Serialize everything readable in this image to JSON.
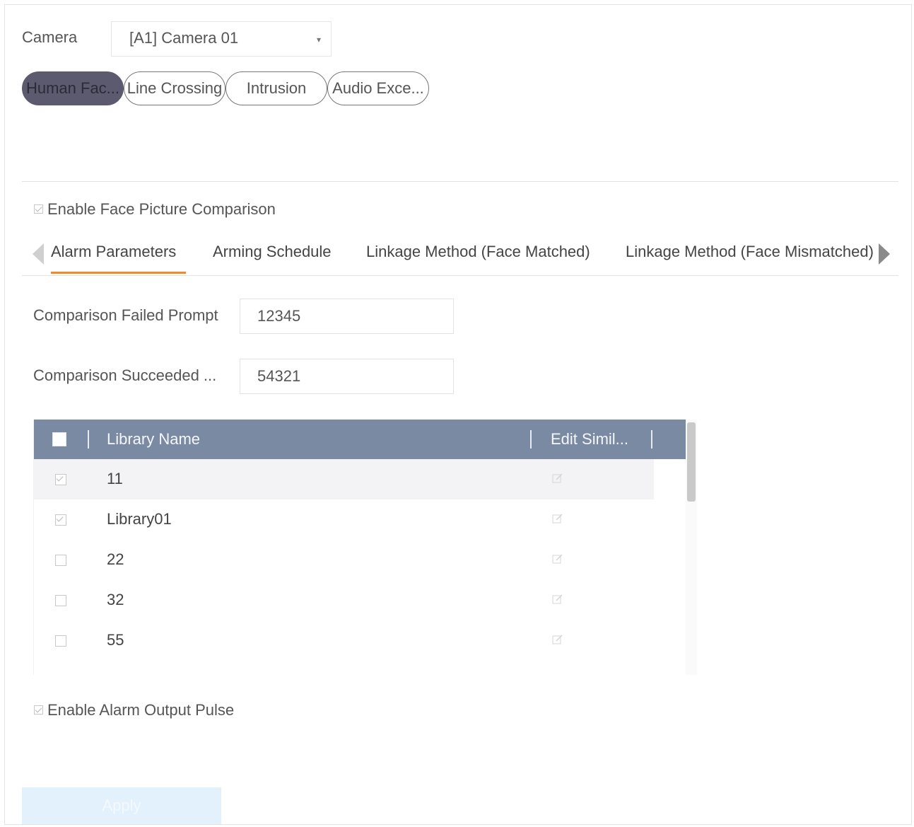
{
  "camera": {
    "label": "Camera",
    "selected": "[A1] Camera 01"
  },
  "event_tabs": [
    {
      "label": "Human Fac..."
    },
    {
      "label": "Line Crossing"
    },
    {
      "label": "Intrusion"
    },
    {
      "label": "Audio Exce..."
    }
  ],
  "enable_face_comparison": {
    "label": "Enable Face Picture Comparison",
    "checked": true
  },
  "sub_tabs": {
    "items": [
      {
        "label": "Alarm Parameters"
      },
      {
        "label": "Arming Schedule"
      },
      {
        "label": "Linkage Method (Face Matched)"
      },
      {
        "label": "Linkage Method (Face Mismatched)"
      }
    ]
  },
  "fields": {
    "failed_prompt": {
      "label": "Comparison Failed Prompt",
      "value": "12345"
    },
    "succeeded_prompt": {
      "label": "Comparison Succeeded ...",
      "value": "54321"
    }
  },
  "library_table": {
    "columns": {
      "name": "Library Name",
      "edit": "Edit Simil..."
    },
    "rows": [
      {
        "name": "11",
        "checked": true
      },
      {
        "name": "Library01",
        "checked": true
      },
      {
        "name": "22",
        "checked": false
      },
      {
        "name": "32",
        "checked": false
      },
      {
        "name": "55",
        "checked": false
      }
    ]
  },
  "enable_alarm_output_pulse": {
    "label": "Enable Alarm Output Pulse",
    "checked": true
  },
  "apply_button": {
    "label": "Apply"
  },
  "colors": {
    "active_tab_underline": "#f08a2a",
    "table_header_bg": "#7a8aa3",
    "active_pill_bg": "#5c5a6e",
    "apply_bg": "#e2f1fb"
  }
}
